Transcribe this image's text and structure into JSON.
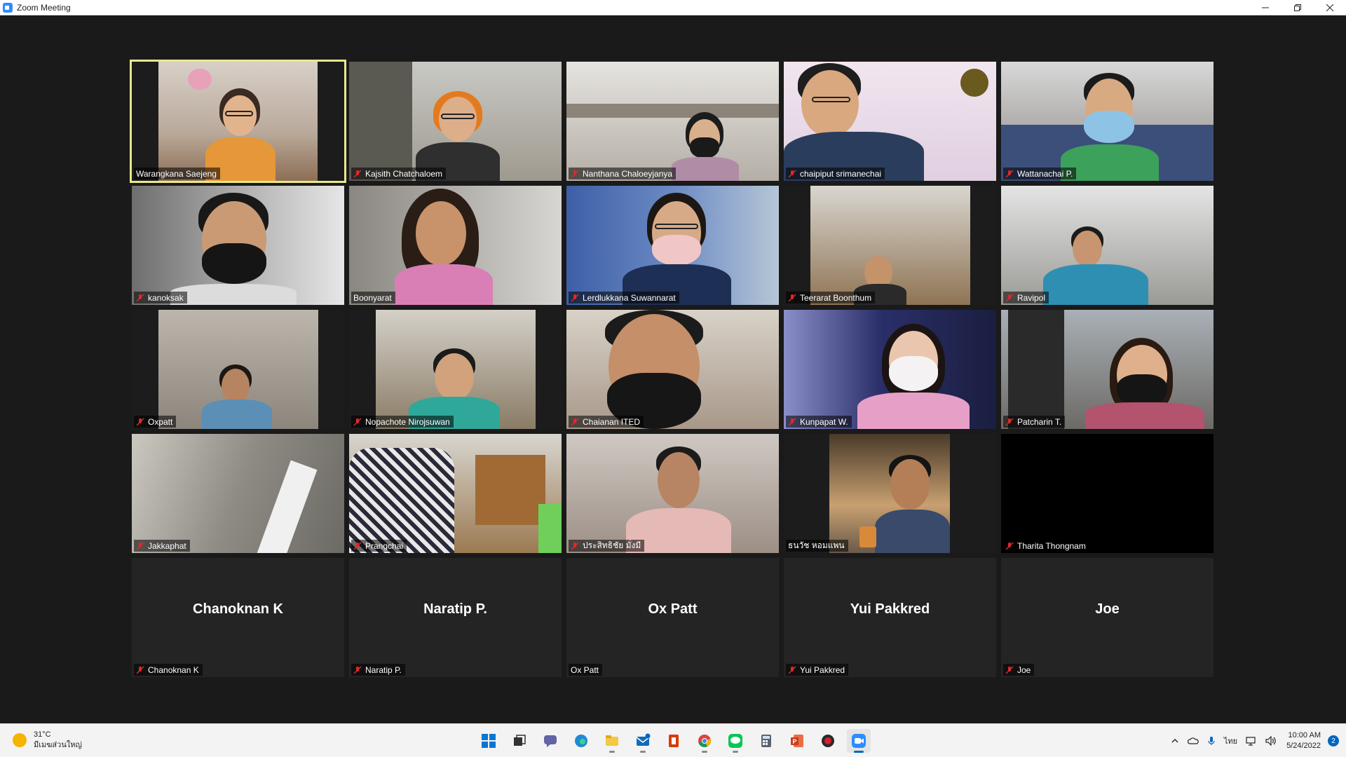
{
  "window": {
    "title": "Zoom Meeting"
  },
  "active_speaker": "Warangkana Saejeng",
  "participants": [
    {
      "name": "Warangkana Saejeng",
      "muted": false,
      "video": true
    },
    {
      "name": "Kajsith Chatchaloem",
      "muted": true,
      "video": true
    },
    {
      "name": "Nanthana Chaloeyjanya",
      "muted": true,
      "video": true
    },
    {
      "name": "chaipiput srimanechai",
      "muted": true,
      "video": true
    },
    {
      "name": "Wattanachai P.",
      "muted": true,
      "video": true
    },
    {
      "name": "kanoksak",
      "muted": true,
      "video": true
    },
    {
      "name": "Boonyarat",
      "muted": false,
      "video": true
    },
    {
      "name": "Lerdlukkana Suwannarat",
      "muted": true,
      "video": true
    },
    {
      "name": "Teerarat Boonthum",
      "muted": true,
      "video": true
    },
    {
      "name": "Ravipol",
      "muted": true,
      "video": true
    },
    {
      "name": "Oxpatt",
      "muted": true,
      "video": true
    },
    {
      "name": "Nopachote Nirojsuwan",
      "muted": true,
      "video": true
    },
    {
      "name": "Chaianan ITED",
      "muted": true,
      "video": true
    },
    {
      "name": "Kunpapat W.",
      "muted": true,
      "video": true
    },
    {
      "name": "Patcharin T.",
      "muted": true,
      "video": true
    },
    {
      "name": "Jakkaphat",
      "muted": true,
      "video": true
    },
    {
      "name": "Prangchai",
      "muted": true,
      "video": true
    },
    {
      "name": "ประสิทธิชัย มั่งมี",
      "muted": true,
      "video": true
    },
    {
      "name": "ธนวัช หอมแพน",
      "muted": false,
      "video": true
    },
    {
      "name": "Tharita Thongnam",
      "muted": true,
      "video": false
    },
    {
      "name": "Chanoknan K",
      "muted": true,
      "video": false
    },
    {
      "name": "Naratip P.",
      "muted": true,
      "video": false
    },
    {
      "name": "Ox Patt",
      "muted": false,
      "video": false
    },
    {
      "name": "Yui Pakkred",
      "muted": true,
      "video": false
    },
    {
      "name": "Joe",
      "muted": true,
      "video": false
    }
  ],
  "taskbar": {
    "weather_temp": "31°C",
    "weather_desc": "มีเมฆส่วนใหญ่",
    "apps": [
      "start",
      "task-view",
      "teams-chat",
      "edge",
      "file-explorer",
      "mail",
      "office",
      "chrome",
      "line",
      "calculator",
      "powerpoint",
      "app-red",
      "zoom"
    ],
    "language": "ไทย",
    "time": "10:00 AM",
    "date": "5/24/2022",
    "notification_count": "2"
  },
  "colors": {
    "active_border": "#e7e889",
    "muted_icon": "#e02828",
    "tile_bg": "#242424",
    "meeting_bg": "#1a1a1a"
  }
}
